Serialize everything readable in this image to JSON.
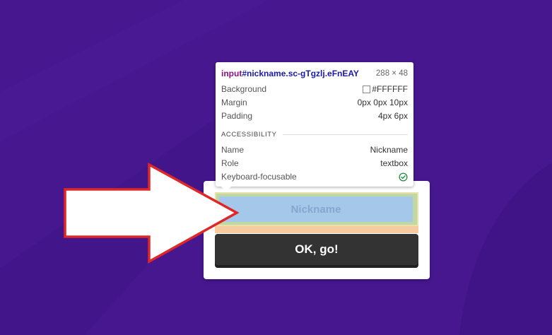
{
  "colors": {
    "background": "#46178f",
    "card": "#ffffff",
    "button": "#333333",
    "arrow_stroke": "#e02727"
  },
  "devtools_tooltip": {
    "tag": "input",
    "selector": "#nickname.sc-gTgzlj.eFnEAY",
    "size": "288 × 48",
    "rows": [
      {
        "label": "Background",
        "value": "#FFFFFF"
      },
      {
        "label": "Margin",
        "value": "0px 0px 10px"
      },
      {
        "label": "Padding",
        "value": "4px 6px"
      }
    ],
    "accessibility_heading": "ACCESSIBILITY",
    "accessibility": [
      {
        "label": "Name",
        "value": "Nickname"
      },
      {
        "label": "Role",
        "value": "textbox"
      },
      {
        "label": "Keyboard-focusable",
        "value": "check-circle-icon"
      }
    ]
  },
  "form": {
    "nickname_placeholder": "Nickname",
    "submit_label": "OK, go!"
  }
}
